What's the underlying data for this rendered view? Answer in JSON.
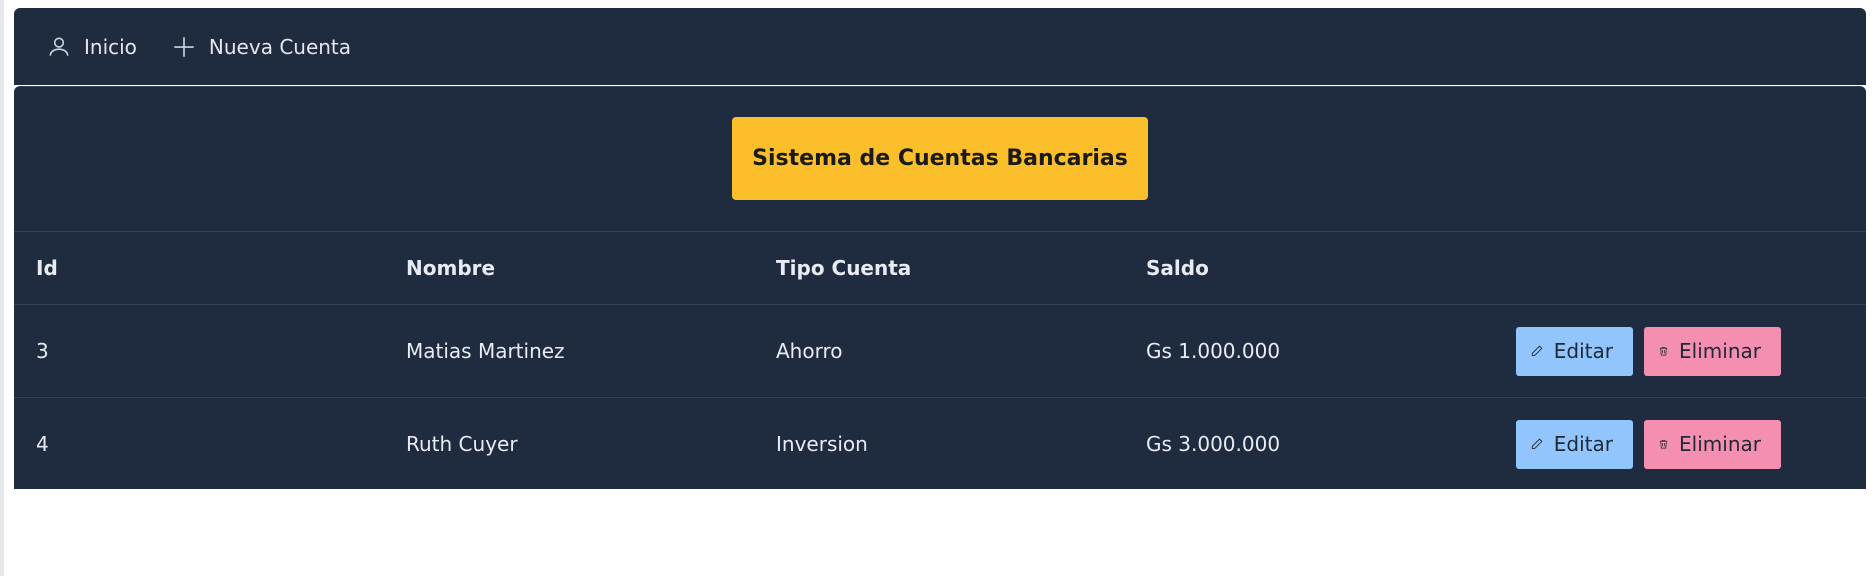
{
  "nav": {
    "items": [
      {
        "label": "Inicio",
        "icon": "user-icon"
      },
      {
        "label": "Nueva Cuenta",
        "icon": "plus-icon"
      }
    ]
  },
  "title": "Sistema de Cuentas Bancarias",
  "table": {
    "headers": [
      "Id",
      "Nombre",
      "Tipo Cuenta",
      "Saldo"
    ],
    "rows": [
      {
        "id": "3",
        "nombre": "Matias Martinez",
        "tipo": "Ahorro",
        "saldo": "Gs 1.000.000"
      },
      {
        "id": "4",
        "nombre": "Ruth Cuyer",
        "tipo": "Inversion",
        "saldo": "Gs 3.000.000"
      }
    ],
    "edit_label": "Editar",
    "delete_label": "Eliminar"
  },
  "colors": {
    "navbar_bg": "#1f2b3f",
    "title_bg": "#fbbf2b",
    "edit_bg": "#93c5fd",
    "delete_bg": "#f48fb1"
  }
}
